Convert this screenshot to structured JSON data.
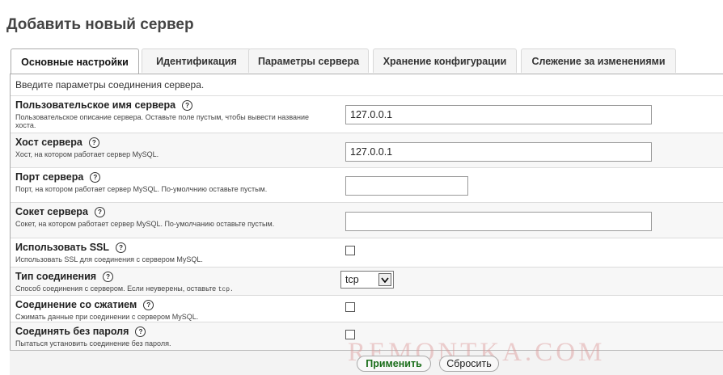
{
  "page": {
    "title": "Добавить новый сервер"
  },
  "tabs": [
    {
      "label": "Основные настройки",
      "active": true
    },
    {
      "label": "Идентификация",
      "active": false
    },
    {
      "label": "Параметры сервера",
      "active": false
    },
    {
      "label": "Хранение конфигурации",
      "active": false
    },
    {
      "label": "Слежение за изменениями",
      "active": false
    }
  ],
  "panel": {
    "intro": "Введите параметры соединения сервера."
  },
  "help_glyph": "?",
  "fields": {
    "verbose": {
      "label": "Пользовательское имя сервера",
      "description": "Пользовательское описание сервера. Оставьте поле пустым, чтобы вывести название хоста.",
      "value": "127.0.0.1"
    },
    "host": {
      "label": "Хост сервера",
      "description": "Хост, на котором работает сервер MySQL.",
      "value": "127.0.0.1"
    },
    "port": {
      "label": "Порт сервера",
      "description": "Порт, на котором работает сервер MySQL. По-умолчнию оставьте пустым.",
      "value": ""
    },
    "socket": {
      "label": "Сокет сервера",
      "description": "Сокет, на котором работает сервер MySQL. По-умолчанию оставьте пустым.",
      "value": ""
    },
    "ssl": {
      "label": "Использовать SSL",
      "description": "Использовать SSL для соединения с сервером MySQL.",
      "checked": false
    },
    "connect_type": {
      "label": "Тип соединения",
      "description": "Способ соединения с сервером. Если неуверены, оставьте",
      "description_code": "tcp.",
      "value": "tcp"
    },
    "compress": {
      "label": "Соединение со сжатием",
      "description": "Сжимать данные при соединении с сервером MySQL.",
      "checked": false
    },
    "nopassword": {
      "label": "Соединять без пароля",
      "description": "Пытаться установить соединение без пароля.",
      "checked": false
    }
  },
  "buttons": {
    "apply": "Применить",
    "reset": "Сбросить"
  },
  "watermark": "REMONTKA.COM",
  "colors": {
    "apply_text": "#1a6e1a",
    "watermark": "#dc9696"
  }
}
